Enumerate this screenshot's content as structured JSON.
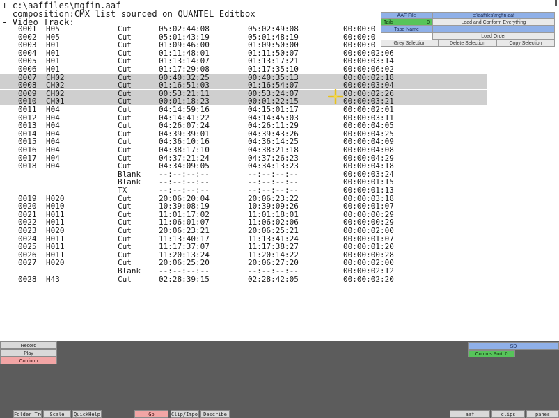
{
  "listing": {
    "file_line": "+ c:\\aaffiles\\mgfin.aaf",
    "composition_line": "  composition:CMX list sourced on QUANTEL Editbox",
    "track_line": "- Video Track:",
    "rows": [
      {
        "id": "0001",
        "tape": "H05",
        "op": "Cut",
        "in": "05:02:44:08",
        "out": "05:02:49:08",
        "dur": "00:00:0",
        "sel": false
      },
      {
        "id": "0002",
        "tape": "H05",
        "op": "Cut",
        "in": "05:01:43:19",
        "out": "05:01:48:19",
        "dur": "00:00:0",
        "sel": false
      },
      {
        "id": "0003",
        "tape": "H01",
        "op": "Cut",
        "in": "01:09:46:00",
        "out": "01:09:50:00",
        "dur": "00:00:0",
        "sel": false
      },
      {
        "id": "0004",
        "tape": "H01",
        "op": "Cut",
        "in": "01:11:48:01",
        "out": "01:11:50:07",
        "dur": "00:00:02:06",
        "sel": false
      },
      {
        "id": "0005",
        "tape": "H01",
        "op": "Cut",
        "in": "01:13:14:07",
        "out": "01:13:17:21",
        "dur": "00:00:03:14",
        "sel": false
      },
      {
        "id": "0006",
        "tape": "H01",
        "op": "Cut",
        "in": "01:17:29:08",
        "out": "01:17:35:10",
        "dur": "00:00:06:02",
        "sel": false
      },
      {
        "id": "0007",
        "tape": "CH02",
        "op": "Cut",
        "in": "00:40:32:25",
        "out": "00:40:35:13",
        "dur": "00:00:02:18",
        "sel": true
      },
      {
        "id": "0008",
        "tape": "CH02",
        "op": "Cut",
        "in": "01:16:51:03",
        "out": "01:16:54:07",
        "dur": "00:00:03:04",
        "sel": true
      },
      {
        "id": "0009",
        "tape": "CH02",
        "op": "Cut",
        "in": "00:53:21:11",
        "out": "00:53:24:07",
        "dur": "00:00:02:26",
        "sel": true
      },
      {
        "id": "0010",
        "tape": "CH01",
        "op": "Cut",
        "in": "00:01:18:23",
        "out": "00:01:22:15",
        "dur": "00:00:03:21",
        "sel": true
      },
      {
        "id": "0011",
        "tape": "H04",
        "op": "Cut",
        "in": "04:14:59:16",
        "out": "04:15:01:17",
        "dur": "00:00:02:01",
        "sel": false
      },
      {
        "id": "0012",
        "tape": "H04",
        "op": "Cut",
        "in": "04:14:41:22",
        "out": "04:14:45:03",
        "dur": "00:00:03:11",
        "sel": false
      },
      {
        "id": "0013",
        "tape": "H04",
        "op": "Cut",
        "in": "04:26:07:24",
        "out": "04:26:11:29",
        "dur": "00:00:04:05",
        "sel": false
      },
      {
        "id": "0014",
        "tape": "H04",
        "op": "Cut",
        "in": "04:39:39:01",
        "out": "04:39:43:26",
        "dur": "00:00:04:25",
        "sel": false
      },
      {
        "id": "0015",
        "tape": "H04",
        "op": "Cut",
        "in": "04:36:10:16",
        "out": "04:36:14:25",
        "dur": "00:00:04:09",
        "sel": false
      },
      {
        "id": "0016",
        "tape": "H04",
        "op": "Cut",
        "in": "04:38:17:10",
        "out": "04:38:21:18",
        "dur": "00:00:04:08",
        "sel": false
      },
      {
        "id": "0017",
        "tape": "H04",
        "op": "Cut",
        "in": "04:37:21:24",
        "out": "04:37:26:23",
        "dur": "00:00:04:29",
        "sel": false
      },
      {
        "id": "0018",
        "tape": "H04",
        "op": "Cut",
        "in": "04:34:09:05",
        "out": "04:34:13:23",
        "dur": "00:00:04:18",
        "sel": false
      },
      {
        "id": "",
        "tape": "",
        "op": "Blank",
        "in": "--:--:--:--",
        "out": "--:--:--:--",
        "dur": "00:00:03:24",
        "sel": false
      },
      {
        "id": "",
        "tape": "",
        "op": "Blank",
        "in": "--:--:--:--",
        "out": "--:--:--:--",
        "dur": "00:00:01:15",
        "sel": false
      },
      {
        "id": "",
        "tape": "",
        "op": "TX",
        "in": "--:--:--:--",
        "out": "--:--:--:--",
        "dur": "00:00:01:13",
        "sel": false
      },
      {
        "id": "0019",
        "tape": "H020",
        "op": "Cut",
        "in": "20:06:20:04",
        "out": "20:06:23:22",
        "dur": "00:00:03:18",
        "sel": false
      },
      {
        "id": "0020",
        "tape": "H010",
        "op": "Cut",
        "in": "10:39:08:19",
        "out": "10:39:09:26",
        "dur": "00:00:01:07",
        "sel": false
      },
      {
        "id": "0021",
        "tape": "H011",
        "op": "Cut",
        "in": "11:01:17:02",
        "out": "11:01:18:01",
        "dur": "00:00:00:29",
        "sel": false
      },
      {
        "id": "0022",
        "tape": "H011",
        "op": "Cut",
        "in": "11:06:01:07",
        "out": "11:06:02:06",
        "dur": "00:00:00:29",
        "sel": false
      },
      {
        "id": "0023",
        "tape": "H020",
        "op": "Cut",
        "in": "20:06:23:21",
        "out": "20:06:25:21",
        "dur": "00:00:02:00",
        "sel": false
      },
      {
        "id": "0024",
        "tape": "H011",
        "op": "Cut",
        "in": "11:13:40:17",
        "out": "11:13:41:24",
        "dur": "00:00:01:07",
        "sel": false
      },
      {
        "id": "0025",
        "tape": "H011",
        "op": "Cut",
        "in": "11:17:37:07",
        "out": "11:17:38:27",
        "dur": "00:00:01:20",
        "sel": false
      },
      {
        "id": "0026",
        "tape": "H011",
        "op": "Cut",
        "in": "11:20:13:24",
        "out": "11:20:14:22",
        "dur": "00:00:00:28",
        "sel": false
      },
      {
        "id": "0027",
        "tape": "H020",
        "op": "Cut",
        "in": "20:06:25:20",
        "out": "20:06:27:20",
        "dur": "00:00:02:00",
        "sel": false
      },
      {
        "id": "",
        "tape": "",
        "op": "Blank",
        "in": "--:--:--:--",
        "out": "--:--:--:--",
        "dur": "00:00:02:12",
        "sel": false
      },
      {
        "id": "0028",
        "tape": "H43",
        "op": "Cut",
        "in": "02:28:39:15",
        "out": "02:28:42:05",
        "dur": "00:00:02:20",
        "sel": false
      }
    ]
  },
  "aaf_panel": {
    "aaf_file_label": "AAF File",
    "aaf_file_value": "c:\\aaffiles\\mgfin.aaf",
    "tails_label": "Tails",
    "tails_value": "0",
    "load_conform_label": "Load and Conform Everything",
    "tape_name_label": "Tape Name",
    "tape_name_value": "",
    "load_order_label": "Load Order",
    "grey_selection_label": "Grey Selection",
    "delete_selection_label": "Delete Selection",
    "copy_selection_label": "Copy Selection"
  },
  "control_panel": {
    "record_label": "Record",
    "play_label": "Play",
    "conform_label": "Conform",
    "sd_label": "SD",
    "comms_port_label": "Comms Port: 0"
  },
  "bottom_bar": {
    "left_buttons": [
      "Folder Tree",
      "Scale",
      "QuickHelp",
      "Go",
      "Clip/Import",
      "Describe"
    ],
    "right_buttons": [
      "aaf",
      "clips",
      "panes"
    ]
  },
  "colors": {
    "panel_grey": "#5c5c5c",
    "selection_grey": "#cfcfcf",
    "pink": "#f2a5a5",
    "blue": "#8fb0e8",
    "green": "#57c45a",
    "cursor_yellow": "#e8c21a"
  }
}
